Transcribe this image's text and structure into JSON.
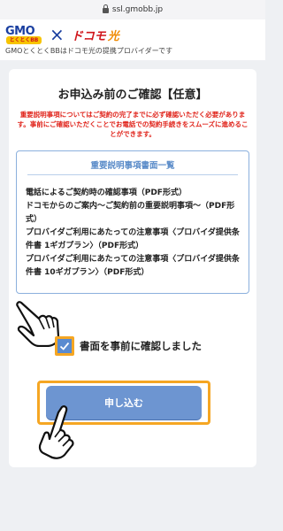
{
  "browser": {
    "url": "ssl.gmobb.jp"
  },
  "header": {
    "brand_gmo": "GMO",
    "brand_gmo_sub": "とくとくBB",
    "brand_docomo": "ドコモ",
    "brand_hikari": "光",
    "tagline": "GMOとくとくBBはドコモ光の提携プロバイダーです"
  },
  "confirm": {
    "title": "お申込み前のご確認【任意】",
    "warning": "重要説明事項についてはご契約の完了までに必ず確認いただく必要があります。事前にご確認いただくことでお電話での契約手続きをスムーズに進めることができます。",
    "docs_heading": "重要説明事項書面一覧",
    "docs": [
      "電話によるご契約時の確認事項（PDF形式）",
      "ドコモからのご案内〜ご契約前の重要説明事項〜（PDF形式）",
      "プロバイダご利用にあたっての注意事項〈プロバイダ提供条件書 1ギガプラン〉（PDF形式）",
      "プロバイダご利用にあたっての注意事項〈プロバイダ提供条件書 10ギガプラン〉（PDF形式）"
    ],
    "checkbox_label": "書面を事前に確認しました",
    "checkbox_checked": true,
    "submit_label": "申し込む"
  },
  "colors": {
    "accent": "#6d95d1",
    "highlight": "#f5a623",
    "warning": "#e0241b"
  }
}
